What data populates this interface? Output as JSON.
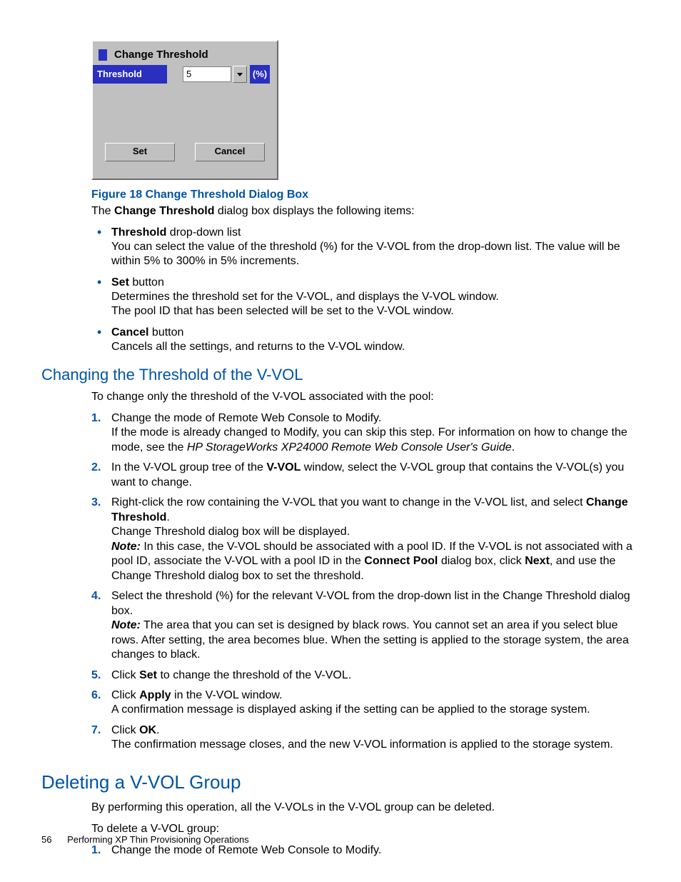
{
  "dialog": {
    "title": "Change Threshold",
    "field_label": "Threshold",
    "value": "5",
    "unit": "(%)",
    "set": "Set",
    "cancel": "Cancel"
  },
  "caption": "Figure 18 Change Threshold Dialog Box",
  "intro_a": "The ",
  "intro_b": "Change Threshold",
  "intro_c": " dialog box displays the following items:",
  "items": [
    {
      "lead_b": "Threshold",
      "lead_t": " drop-down list",
      "body": "You can select the value of the threshold (%) for the V-VOL from the drop-down list. The value will be within 5% to 300% in 5% increments."
    },
    {
      "lead_b": "Set",
      "lead_t": " button",
      "body": "Determines the threshold set for the V-VOL, and displays the V-VOL window.\nThe pool ID that has been selected will be set to the V-VOL window."
    },
    {
      "lead_b": "Cancel",
      "lead_t": " button",
      "body": "Cancels all the settings, and returns to the V-VOL window."
    }
  ],
  "h3": "Changing the Threshold of the V-VOL",
  "h3_intro": "To change only the threshold of the V-VOL associated with the pool:",
  "steps": {
    "s1a": "Change the mode of Remote Web Console to Modify.",
    "s1b": "If the mode is already changed to Modify, you can skip this step. For information on how to change the mode, see the ",
    "s1c": "HP StorageWorks XP24000 Remote Web Console User's Guide",
    "s1d": ".",
    "s2a": "In the V-VOL group tree of the ",
    "s2b": "V-VOL",
    "s2c": " window, select the V-VOL group that contains the V-VOL(s) you want to change.",
    "s3a": "Right-click the row containing the V-VOL that you want to change in the V-VOL list, and select ",
    "s3b": "Change Threshold",
    "s3c": ".",
    "s3d": "Change Threshold dialog box will be displayed.",
    "s3e": "Note:",
    "s3f": " In this case, the V-VOL should be associated with a pool ID. If the V-VOL is not associated with a pool ID, associate the V-VOL with a pool ID in the ",
    "s3g": "Connect Pool",
    "s3h": " dialog box, click ",
    "s3i": "Next",
    "s3j": ", and use the Change Threshold dialog box to set the threshold.",
    "s4a": "Select the threshold (%) for the relevant V-VOL from the drop-down list in the Change Threshold dialog box.",
    "s4b": "Note:",
    "s4c": " The area that you can set is designed by black rows. You cannot set an area if you select blue rows. After setting, the area becomes blue. When the setting is applied to the storage system, the area changes to black.",
    "s5a": "Click ",
    "s5b": "Set",
    "s5c": " to change the threshold of the V-VOL.",
    "s6a": "Click ",
    "s6b": "Apply",
    "s6c": " in the V-VOL window.",
    "s6d": "A confirmation message is displayed asking if the setting can be applied to the storage system.",
    "s7a": "Click ",
    "s7b": "OK",
    "s7c": ".",
    "s7d": "The confirmation message closes, and the new V-VOL information is applied to the storage system."
  },
  "h2": "Deleting a V-VOL Group",
  "h2p1": "By performing this operation, all the V-VOLs in the V-VOL group can be deleted.",
  "h2p2": "To delete a V-VOL group:",
  "h2s1": "Change the mode of Remote Web Console to Modify.",
  "footer": {
    "page": "56",
    "title": "Performing XP Thin Provisioning Operations"
  }
}
